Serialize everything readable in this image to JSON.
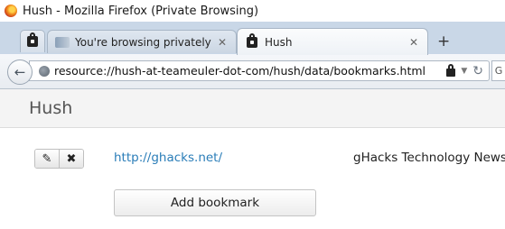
{
  "window": {
    "title": "Hush - Mozilla Firefox (Private Browsing)"
  },
  "tabs": [
    {
      "label": "You're browsing privately",
      "active": false
    },
    {
      "label": "Hush",
      "active": true
    }
  ],
  "toolbar": {
    "url": "resource://hush-at-teameuler-dot-com/hush/data/bookmarks.html",
    "new_tab_symbol": "+",
    "close_symbol": "✕"
  },
  "page": {
    "title": "Hush",
    "bookmarks": [
      {
        "url": "http://ghacks.net/",
        "title": "gHacks Technology News"
      }
    ],
    "add_button_label": "Add bookmark"
  },
  "icons": {
    "edit": "edit-icon",
    "delete": "delete-icon",
    "back": "back-arrow-icon",
    "reload": "reload-icon",
    "lock": "lock-icon"
  }
}
